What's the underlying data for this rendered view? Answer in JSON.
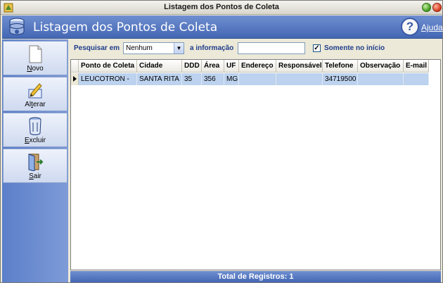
{
  "window": {
    "title": "Listagem dos Pontos de Coleta"
  },
  "banner": {
    "title": "Listagem dos Pontos de Coleta",
    "help_label": "Ajuda",
    "help_glyph": "?"
  },
  "toolbar": {
    "buttons": [
      {
        "key": "N",
        "rest": "ovo",
        "icon": "new-document-icon"
      },
      {
        "pre": "Al",
        "key": "t",
        "rest": "erar",
        "icon": "edit-pencil-icon"
      },
      {
        "key": "E",
        "rest": "xcluir",
        "icon": "trash-can-icon"
      },
      {
        "key": "S",
        "rest": "air",
        "icon": "exit-door-icon"
      }
    ]
  },
  "filter": {
    "search_in_label": "Pesquisar em",
    "search_in_value": "Nenhum",
    "info_label": "a informação",
    "info_value": "",
    "only_start_label": "Somente no início",
    "only_start_checked": true,
    "check_glyph": "✓"
  },
  "grid": {
    "columns": [
      "Ponto de Coleta",
      "Cidade",
      "DDD",
      "Área",
      "UF",
      "Endereço",
      "Responsável",
      "Telefone",
      "Observação",
      "E-mail"
    ],
    "rows": [
      [
        "LEUCOTRON -",
        "SANTA RITA",
        "35",
        "356",
        "MG",
        "",
        "",
        "34719500",
        "",
        ""
      ]
    ]
  },
  "footer": {
    "total_label": "Total de Registros: 1"
  },
  "colors": {
    "accent": "#4467b4",
    "selected_row": "#bcd2ee"
  }
}
